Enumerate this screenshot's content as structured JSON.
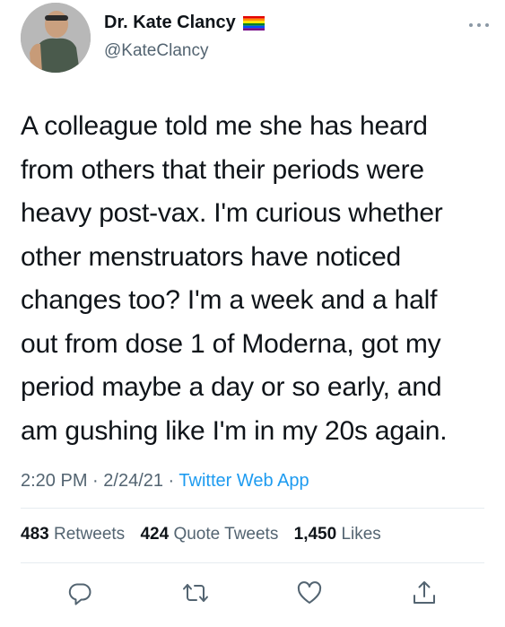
{
  "author": {
    "display_name": "Dr. Kate Clancy",
    "handle": "@KateClancy",
    "flag_icon": "rainbow-flag-icon"
  },
  "tweet": {
    "lines": [
      "A colleague told me she has heard",
      "from others that their periods were",
      "heavy post-vax. I'm curious whether",
      "other menstruators have noticed",
      "changes too? I'm a week and a half",
      "out from dose 1 of Moderna, got my",
      "period maybe a day or so early, and",
      "am gushing like I'm in my 20s again."
    ],
    "time": "2:20 PM",
    "separator": " · ",
    "date": "2/24/21",
    "source": "Twitter Web App"
  },
  "stats": {
    "retweets_count": "483",
    "retweets_label": "Retweets",
    "quotes_count": "424",
    "quotes_label": "Quote Tweets",
    "likes_count": "1,450",
    "likes_label": "Likes"
  },
  "colors": {
    "text": "#0f1419",
    "secondary": "#536471",
    "accent": "#1d9bf0",
    "divider": "#e6ecf0"
  }
}
